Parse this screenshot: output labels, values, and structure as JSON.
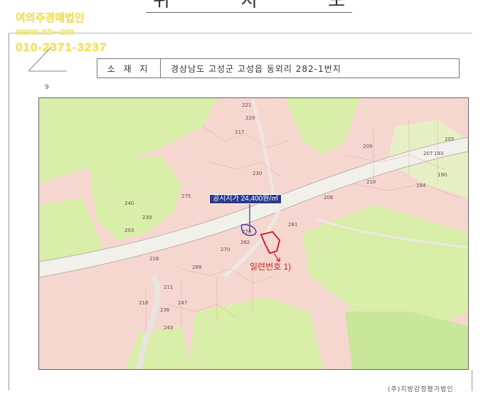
{
  "header": {
    "title_chars": [
      "위",
      "치",
      "도"
    ]
  },
  "watermark": {
    "company": "여의주경매법인",
    "website": "www.xn--om",
    "phone": "010-2371-3237"
  },
  "address_box": {
    "label": "소 재 지",
    "value": "경상남도 고성군 고성읍 동외리 282-1번지"
  },
  "section_mark": "9",
  "map": {
    "price_label": "공시지가 24,400원/㎡",
    "lot_label": "일련번호 1)",
    "lot_numbers": [
      "221",
      "229",
      "217",
      "230",
      "208",
      "240",
      "239",
      "210",
      "275",
      "276",
      "282",
      "270",
      "218",
      "211",
      "207",
      "243",
      "247",
      "205",
      "209",
      "216",
      "289",
      "236",
      "203",
      "281",
      "193",
      "190",
      "184"
    ]
  },
  "footer": "(주)지방감정평가법인",
  "colors": {
    "parcel": "#f6d7cf",
    "forest": "#d9eea9",
    "road": "#f2f0ea",
    "label_bg": "#2a3a8c",
    "lot": "#c0262a"
  }
}
